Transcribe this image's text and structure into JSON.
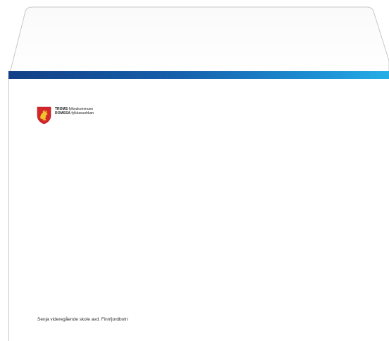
{
  "logo": {
    "line1_bold": "TROMS",
    "line1_rest": "fylkeskommune",
    "line2_bold": "ROMSSA",
    "line2_rest": "fylkkasuohkan",
    "shield_icon": "coat-of-arms-icon"
  },
  "sender": {
    "text": "Senja videregående skole avd. Finnfjordbotn"
  },
  "colors": {
    "band_start": "#123f86",
    "band_end": "#27aee6",
    "shield_red": "#d4262b",
    "shield_gold": "#f2c12e"
  }
}
